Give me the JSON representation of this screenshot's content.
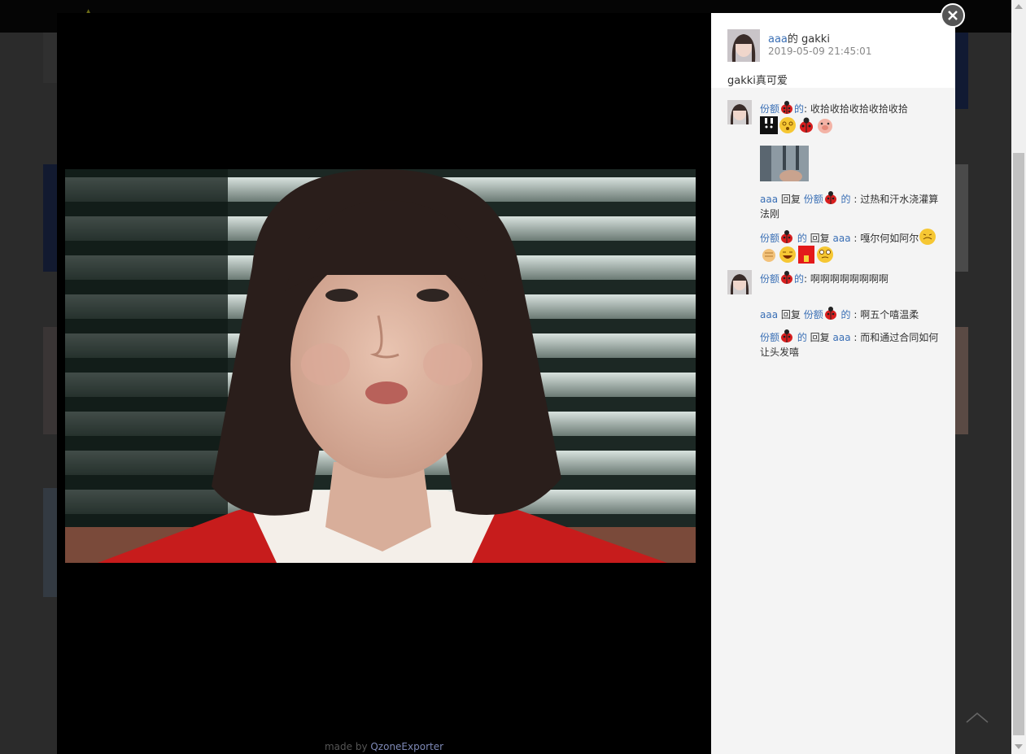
{
  "viewer": {
    "footer_prefix": "made by ",
    "footer_link": "QzoneExporter"
  },
  "post": {
    "author": "aaa",
    "author_suffix": "的 gakki",
    "time": "2019-05-09 21:45:01",
    "text": "gakki真可爱"
  },
  "comments": [
    {
      "author": "份额",
      "author_suffix": "的",
      "separator": ": ",
      "text": "收拾收拾收拾收拾收拾",
      "emojis": [
        "rabbit-emoji",
        "dizzy-face-emoji",
        "ladybug-emoji",
        "pig-emoji"
      ],
      "has_image": true,
      "replies": [
        {
          "from": "aaa",
          "verb": " 回复 ",
          "to": "份额",
          "to_suffix": " 的",
          "separator": " : ",
          "text": "过热和汗水浇灌算法刚",
          "emojis": []
        },
        {
          "from": "份额",
          "from_suffix": " 的",
          "verb": " 回复 ",
          "to": "aaa",
          "separator": " : ",
          "text": "嘎尔何如阿尔",
          "emojis": [
            "grimace-emoji",
            "fist-emoji",
            "laugh-emoji",
            "red-envelope-emoji",
            "eye-roll-emoji"
          ]
        }
      ]
    },
    {
      "author": "份额",
      "author_suffix": "的",
      "separator": ": ",
      "text": "啊啊啊啊啊啊啊啊",
      "emojis": [],
      "has_image": false,
      "replies": [
        {
          "from": "aaa",
          "verb": " 回复 ",
          "to": "份额",
          "to_suffix": " 的",
          "separator": " : ",
          "text": "啊五个嘻温柔",
          "emojis": []
        },
        {
          "from": "份额",
          "from_suffix": " 的",
          "verb": " 回复 ",
          "to": "aaa",
          "separator": " : ",
          "text": "而和通过合同如何让头发嘻",
          "emojis": []
        }
      ]
    }
  ],
  "colors": {
    "link": "#3a6fb5",
    "panel_bg": "#f4f4f4",
    "viewer_bg": "#000000",
    "close_bg": "#555555"
  }
}
